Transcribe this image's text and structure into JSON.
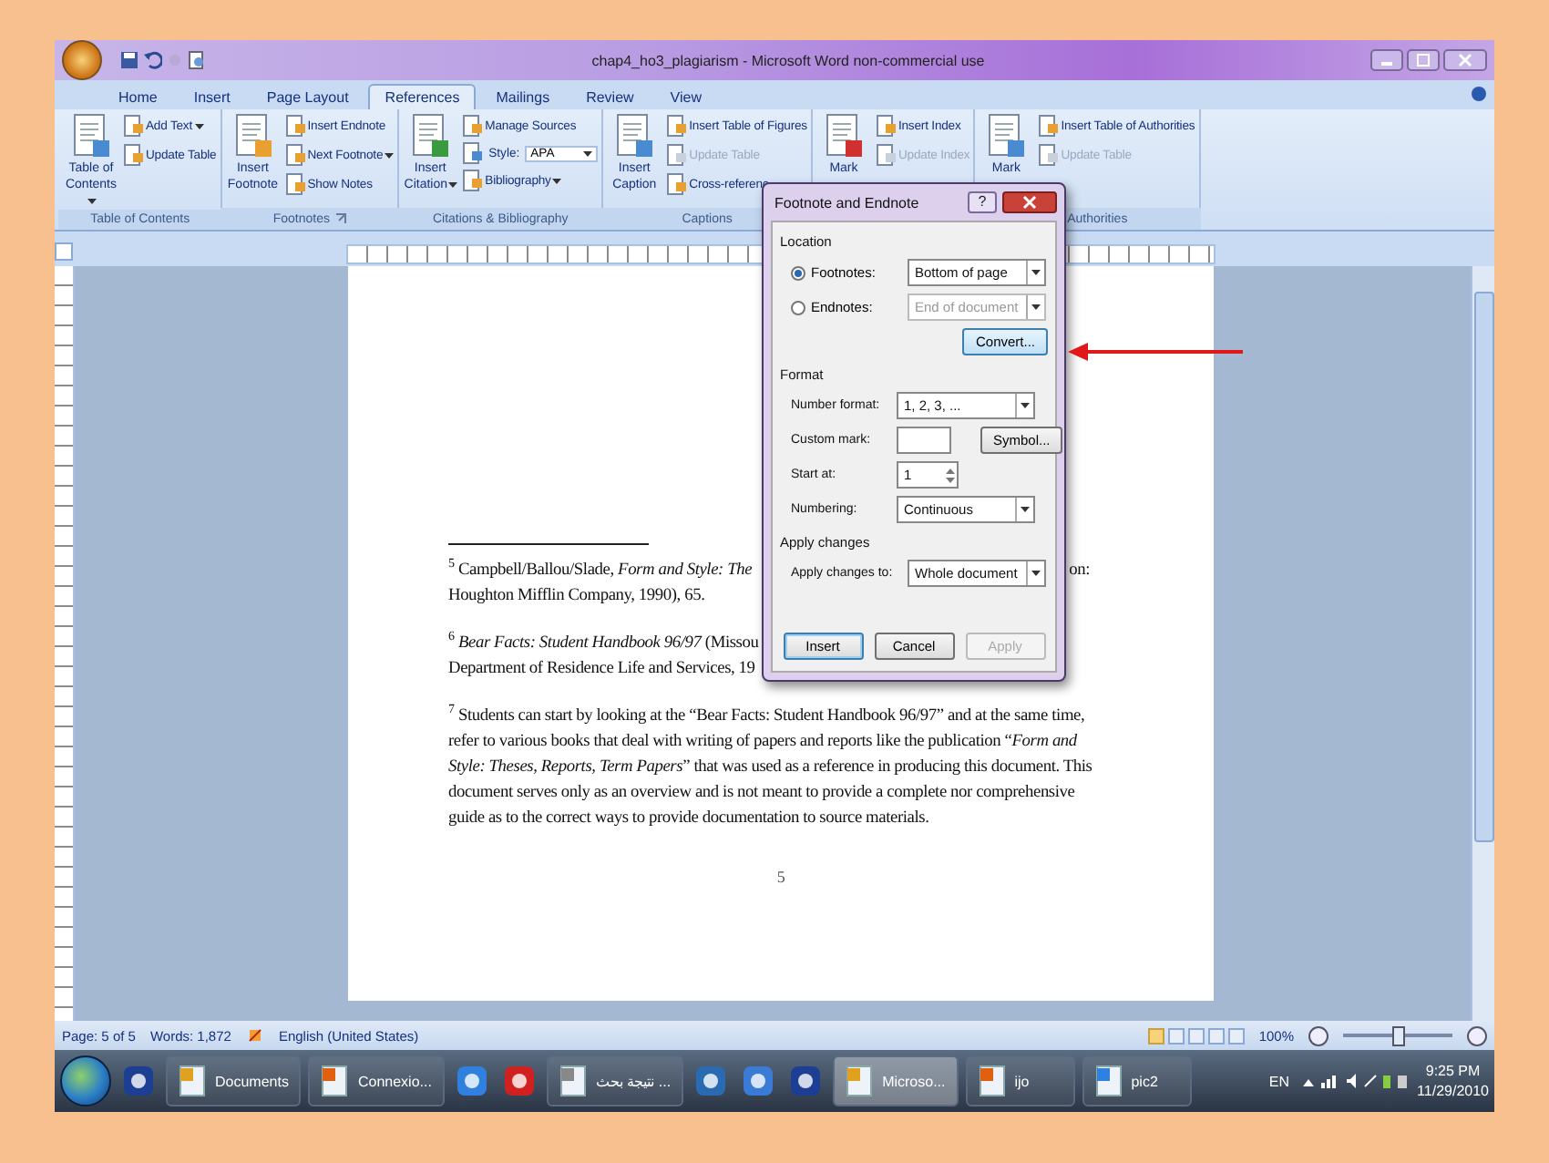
{
  "window": {
    "title": "chap4_ho3_plagiarism - Microsoft Word non-commercial use"
  },
  "tabs": [
    {
      "label": "Home",
      "selected": false
    },
    {
      "label": "Insert",
      "selected": false
    },
    {
      "label": "Page Layout",
      "selected": false
    },
    {
      "label": "References",
      "selected": true
    },
    {
      "label": "Mailings",
      "selected": false
    },
    {
      "label": "Review",
      "selected": false
    },
    {
      "label": "View",
      "selected": false
    }
  ],
  "ribbon": {
    "groups": [
      {
        "label": "Table of Contents",
        "launcher": false,
        "large": {
          "label": "Table of Contents",
          "dropdown": true
        },
        "items": [
          {
            "kind": "button",
            "label": "Add Text",
            "dropdown": true,
            "disabled": false
          },
          {
            "kind": "button",
            "label": "Update Table",
            "dropdown": false,
            "disabled": false
          }
        ]
      },
      {
        "label": "Footnotes",
        "launcher": true,
        "large": {
          "label": "Insert Footnote",
          "dropdown": false
        },
        "items": [
          {
            "kind": "button",
            "label": "Insert Endnote",
            "dropdown": false,
            "disabled": false
          },
          {
            "kind": "button",
            "label": "Next Footnote",
            "dropdown": true,
            "disabled": false
          },
          {
            "kind": "button",
            "label": "Show Notes",
            "dropdown": false,
            "disabled": false
          }
        ]
      },
      {
        "label": "Citations & Bibliography",
        "launcher": false,
        "large": {
          "label": "Insert Citation",
          "dropdown": true
        },
        "items": [
          {
            "kind": "button",
            "label": "Manage Sources",
            "dropdown": false,
            "disabled": false
          },
          {
            "kind": "combo",
            "label": "Style:",
            "value": "APA"
          },
          {
            "kind": "button",
            "label": "Bibliography",
            "dropdown": true,
            "disabled": false
          }
        ]
      },
      {
        "label": "Captions",
        "launcher": false,
        "large": {
          "label": "Insert Caption",
          "dropdown": false
        },
        "items": [
          {
            "kind": "button",
            "label": "Insert Table of Figures",
            "dropdown": false,
            "disabled": false
          },
          {
            "kind": "button",
            "label": "Update Table",
            "dropdown": false,
            "disabled": true
          },
          {
            "kind": "button",
            "label": "Cross-referenc",
            "dropdown": false,
            "disabled": false
          }
        ]
      },
      {
        "launcher": false,
        "large": {
          "label": "Mark",
          "dropdown": false
        },
        "items": [
          {
            "kind": "button",
            "label": "Insert Index",
            "dropdown": false,
            "disabled": false
          },
          {
            "kind": "button",
            "label": "Update Index",
            "dropdown": false,
            "disabled": true
          }
        ]
      },
      {
        "label": "Authorities",
        "launcher": false,
        "large": {
          "label": "Mark",
          "dropdown": false
        },
        "items": [
          {
            "kind": "button",
            "label": "Insert Table of Authorities",
            "dropdown": false,
            "disabled": false
          },
          {
            "kind": "button",
            "label": "Update Table",
            "dropdown": false,
            "disabled": true
          }
        ]
      }
    ]
  },
  "document": {
    "footnotes": [
      {
        "kind": "lines",
        "lines": [
          {
            "left": "$^{5}$ Campbell/Ballou/Slade, *Form and Style: The*",
            "right": "on:"
          },
          {
            "left": "Houghton Mifflin Company, 1990), 65."
          }
        ]
      },
      {
        "kind": "lines",
        "lines": [
          {
            "left": "$^{6}$ *Bear Facts: Student Handbook 96/97* (Missou"
          },
          {
            "left": "Department of Residence Life and Services, 19"
          }
        ]
      },
      {
        "kind": "paragraph",
        "text": "$^{7}$ Students can start by looking at the “Bear Facts: Student Handbook 96/97” and at the same time, refer to various books that deal with writing of papers and reports like the publication “*Form and Style: Theses, Reports, Term Papers*” that was used as a reference in producing this document.  This document serves only as an overview and is not meant to provide a complete nor comprehensive  guide as to the correct ways to provide documentation to source materials."
      }
    ],
    "page_number": "5"
  },
  "dialog": {
    "title": "Footnote and Endnote",
    "help": "?",
    "location": {
      "label": "Location",
      "options": [
        {
          "label": "Footnotes:",
          "selected": true,
          "value": "Bottom of page",
          "disabled": false
        },
        {
          "label": "Endnotes:",
          "selected": false,
          "value": "End of document",
          "disabled": true
        }
      ],
      "convert": "Convert..."
    },
    "format": {
      "label": "Format",
      "number_format": {
        "label": "Number format:",
        "value": "1, 2, 3, ..."
      },
      "custom_mark": {
        "label": "Custom mark:",
        "button": "Symbol..."
      },
      "start_at": {
        "label": "Start at:",
        "value": "1"
      },
      "numbering": {
        "label": "Numbering:",
        "value": "Continuous"
      }
    },
    "apply_changes": {
      "label": "Apply changes",
      "apply_to": {
        "label": "Apply changes to:",
        "value": "Whole document"
      }
    },
    "buttons": [
      {
        "label": "Insert",
        "disabled": false
      },
      {
        "label": "Cancel",
        "disabled": false
      },
      {
        "label": "Apply",
        "disabled": true
      }
    ]
  },
  "status_bar": {
    "page": "Page: 5 of 5",
    "words": "Words: 1,872",
    "language": "English (United States)",
    "zoom": "100%",
    "zoom_slider": {
      "level": 0.5
    }
  },
  "taskbar": {
    "items": [
      {
        "kind": "start"
      },
      {
        "kind": "icon"
      },
      {
        "kind": "button",
        "label": "Documents",
        "selected": false
      },
      {
        "kind": "button",
        "label": "Connexio...",
        "selected": false
      },
      {
        "kind": "icon"
      },
      {
        "kind": "icon"
      },
      {
        "kind": "button",
        "label": "نتيجة بحث ...",
        "selected": false
      },
      {
        "kind": "icon"
      },
      {
        "kind": "icon"
      },
      {
        "kind": "icon"
      },
      {
        "kind": "button",
        "label": "Microso...",
        "selected": true
      },
      {
        "kind": "button",
        "label": "ijo",
        "selected": false
      },
      {
        "kind": "button",
        "label": "pic2",
        "selected": false
      }
    ],
    "language": "EN",
    "time": "9:25 PM",
    "date": "11/29/2010"
  }
}
